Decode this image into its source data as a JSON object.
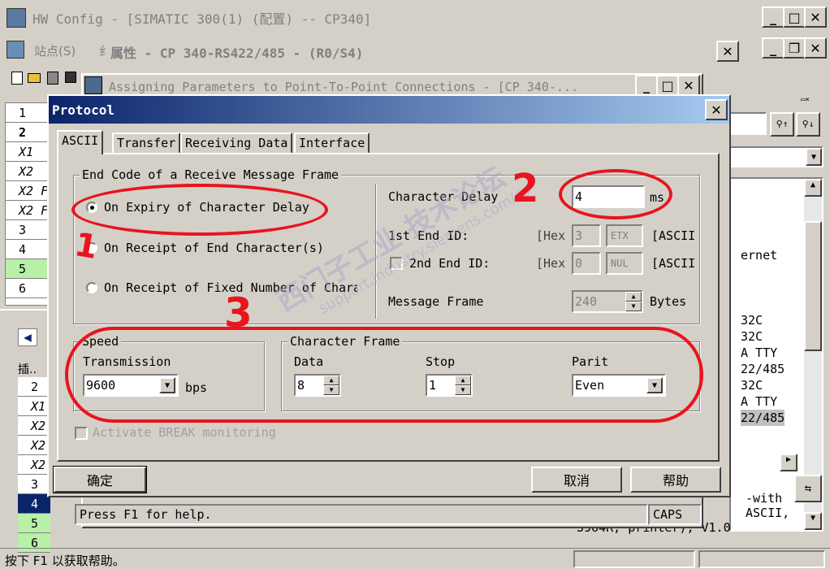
{
  "main_window": {
    "title": "HW Config - [SIMATIC 300(1) (配置) -- CP340]"
  },
  "menu": {
    "station": "站点(S)",
    "trunc": "纟"
  },
  "status_bar": {
    "text": "按下 F1 以获取帮助。"
  },
  "properties_window": {
    "title": "属性 - CP 340-RS422/485 - (R0/S4)"
  },
  "assign_window": {
    "title": "Assigning Parameters to Point-To-Point Connections - [CP 340-..."
  },
  "assign_status": {
    "help": "Press F1 for help.",
    "caps": "CAPS"
  },
  "right_panel": {
    "lines": [
      "ernet",
      "32C",
      "32C",
      "A TTY",
      "22/485",
      "32C",
      "A TTY",
      "22/485"
    ],
    "bottom_text": [
      "-with",
      "ASCII,",
      "3964R, printer), V1.0"
    ]
  },
  "left_grid_top": {
    "rows": [
      "1",
      "2",
      "X1",
      "X2",
      "X2 F",
      "X2 F",
      "3",
      "4",
      "5",
      "6"
    ]
  },
  "left_grid_bottom": {
    "header": "插..",
    "rows": [
      "2",
      "X1",
      "X2",
      "X2",
      "X2",
      "3",
      "4",
      "5",
      "6"
    ]
  },
  "dialog": {
    "title": "Protocol",
    "tabs": [
      "ASCII",
      "Transfer",
      "Receiving Data",
      "Interface"
    ],
    "end_code_group": "End Code of a Receive Message Frame",
    "radio_options": [
      "On Expiry of Character Delay",
      "On Receipt of End Character(s)",
      "On Receipt of Fixed Number of Chara"
    ],
    "char_delay_label": "Character Delay",
    "char_delay_value": "4",
    "char_delay_unit": "ms",
    "end_id1_label": "1st End ID:",
    "end_id2_label": "2nd End ID:",
    "hex_label": "[Hex",
    "end_id1_hex": "3",
    "end_id1_ascii": "ETX",
    "end_id2_hex": "0",
    "end_id2_ascii": "NUL",
    "ascii_label": "[ASCII",
    "message_frame_label": "Message Frame",
    "message_frame_value": "240",
    "message_frame_unit": "Bytes",
    "speed_group": "Speed",
    "transmission_label": "Transmission",
    "transmission_value": "9600",
    "transmission_unit": "bps",
    "char_frame_group": "Character Frame",
    "data_label": "Data",
    "data_value": "8",
    "stop_label": "Stop",
    "stop_value": "1",
    "parity_label": "Parit",
    "parity_value": "Even",
    "break_label": "Activate BREAK monitoring",
    "ok": "确定",
    "cancel": "取消",
    "help": "帮助"
  },
  "annotations": {
    "n1": "1",
    "n2": "2",
    "n3": "3"
  },
  "watermark": {
    "cn": "西门子工业 技术论坛",
    "url": "support.industry.siemens.com/cs"
  },
  "colors": {
    "title_active": "#0a246a",
    "annotation_red": "#e8141e",
    "row_green": "#b8f0a8",
    "row_selected": "#0a246a"
  }
}
